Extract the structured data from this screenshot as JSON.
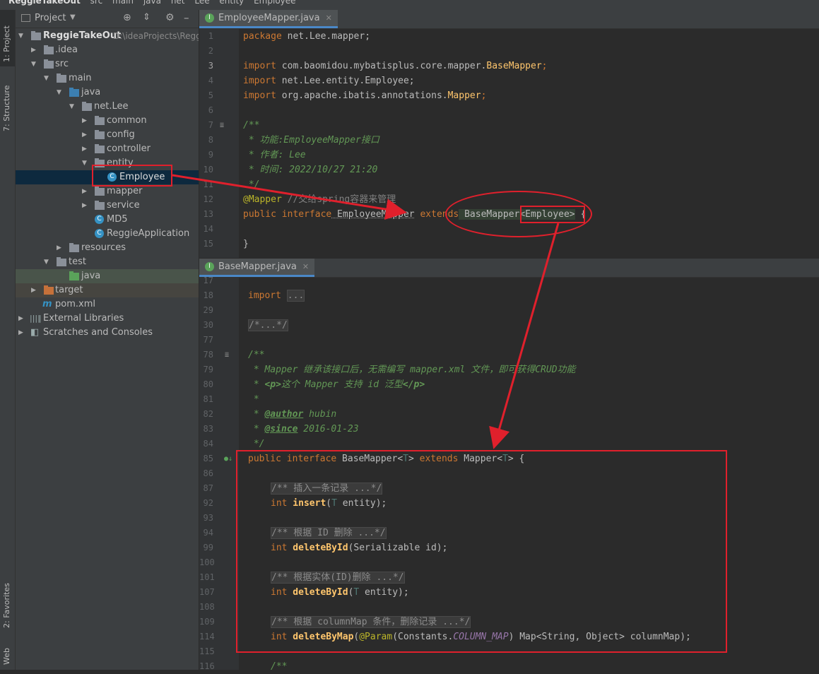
{
  "breadcrumb": [
    "ReggieTakeOut",
    "src",
    "main",
    "java",
    "net",
    "Lee",
    "entity",
    "Employee"
  ],
  "toolwindows": {
    "project": "1: Project",
    "structure": "7: Structure",
    "favorites": "2: Favorites",
    "web": "Web"
  },
  "project_panel": {
    "title": "Project",
    "tree": [
      {
        "label": "ReggieTakeOut",
        "suffix": "D:\\ideaProjects\\Regg",
        "bold": true
      },
      {
        "label": ".idea"
      },
      {
        "label": "src"
      },
      {
        "label": "main"
      },
      {
        "label": "java"
      },
      {
        "label": "net.Lee"
      },
      {
        "label": "common"
      },
      {
        "label": "config"
      },
      {
        "label": "controller"
      },
      {
        "label": "entity"
      },
      {
        "label": "Employee"
      },
      {
        "label": "mapper"
      },
      {
        "label": "service"
      },
      {
        "label": "MD5"
      },
      {
        "label": "ReggieApplication"
      },
      {
        "label": "resources"
      },
      {
        "label": "test"
      },
      {
        "label": "java"
      },
      {
        "label": "target"
      },
      {
        "label": "pom.xml"
      },
      {
        "label": "External Libraries"
      },
      {
        "label": "Scratches and Consoles"
      }
    ]
  },
  "editor_top": {
    "tab": "EmployeeMapper.java",
    "line_numbers": [
      "1",
      "2",
      "3",
      "4",
      "5",
      "6",
      "7",
      "8",
      "9",
      "10",
      "11",
      "12",
      "13",
      "14",
      "15"
    ],
    "lines": {
      "l1a": "package",
      "l1b": " net.Lee.mapper;",
      "l3a": "import",
      "l3b": " com.baomidou.mybatisplus.core.mapper.",
      "l3c": "BaseMapper",
      "l3d": ";",
      "l4a": "import",
      "l4b": " net.Lee.entity.Employee;",
      "l5a": "import",
      "l5b": " org.apache.ibatis.annotations.",
      "l5c": "Mapper",
      "l5d": ";",
      "l7": "/**",
      "l8": " * 功能:EmployeeMapper接口",
      "l9": " * 作者: Lee",
      "l10": " * 时间: 2022/10/27 21:20",
      "l11": " */",
      "l12a": "@Mapper",
      "l12b": " //交给spring容器来管理",
      "l13a": "public interface",
      "l13b": " EmployeeMapper",
      "l13c": " extends",
      "l13d": " BaseMapper",
      "l13e": "<Employee>",
      "l13f": " {",
      "l15": "}"
    }
  },
  "editor_bottom": {
    "tab": "BaseMapper.java",
    "line_numbers": [
      "17",
      "18",
      "29",
      "30",
      "77",
      "78",
      "79",
      "80",
      "81",
      "82",
      "83",
      "84",
      "85",
      "86",
      "87",
      "92",
      "93",
      "94",
      "99",
      "100",
      "101",
      "107",
      "108",
      "109",
      "114",
      "115",
      "116"
    ],
    "lines": {
      "import_kw": "import",
      "import_fold": "...",
      "fold30": "/*...*/",
      "l78": "/**",
      "l79a": " * ",
      "l79b": "Mapper",
      "l79c": " 继承该接口后，无需编写 ",
      "l79d": "mapper.xml",
      "l79e": " 文件，即可获得",
      "l79f": "CRUD",
      "l79g": "功能",
      "l80a": " * ",
      "l80b": "<p>",
      "l80c": "这个 Mapper 支持 id 泛型",
      "l80d": "</p>",
      "l81": " *",
      "l82a": " * ",
      "l82b": "@author",
      "l82c": " hubin",
      "l83a": " * ",
      "l83b": "@since",
      "l83c": " 2016-01-23",
      "l84": " */",
      "l85a": "public interface",
      "l85b": " BaseMapper<",
      "l85c": "T",
      "l85d": "> ",
      "l85e": "extends",
      "l85f": " Mapper<",
      "l85g": "T",
      "l85h": "> {",
      "l87": "/** 插入一条记录 ...*/",
      "l92a": "int",
      "l92b": " insert",
      "l92c": "(",
      "l92d": "T",
      "l92e": " entity);",
      "l94": "/** 根据 ID 删除 ...*/",
      "l99a": "int",
      "l99b": " deleteById",
      "l99c": "(Serializable id);",
      "l101": "/** 根据实体(ID)删除 ...*/",
      "l107a": "int",
      "l107b": " deleteById",
      "l107c": "(",
      "l107d": "T",
      "l107e": " entity);",
      "l109": "/** 根据 columnMap 条件，删除记录 ...*/",
      "l114a": "int",
      "l114b": " deleteByMap",
      "l114c": "(",
      "l114d": "@Param",
      "l114e": "(Constants.",
      "l114f": "COLUMN_MAP",
      "l114g": ") Map<String, Object> columnMap);",
      "l116": "/**"
    }
  },
  "colors": {
    "annotation_red": "#e0202c",
    "keyword": "#cc7832",
    "comment": "#629755",
    "selection": "#0d293e"
  }
}
